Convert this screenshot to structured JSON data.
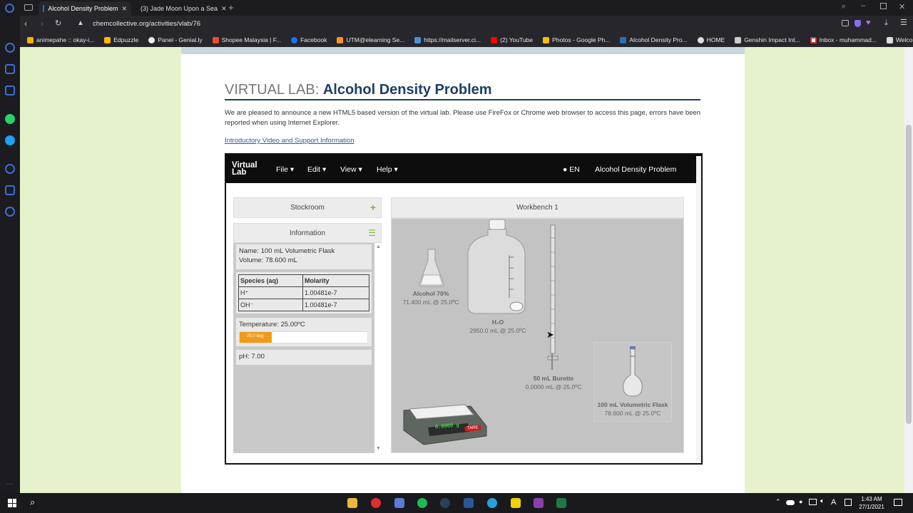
{
  "browser": {
    "tabs": [
      {
        "title": "Alcohol Density Problem",
        "active": true
      },
      {
        "title": "(3) Jade Moon Upon a Sea",
        "active": false
      }
    ],
    "url": "chemcollective.org/activities/vlab/76",
    "bookmarks": [
      "animepahe :: okay-i...",
      "Edpuzzle",
      "Panel - Genial.ly",
      "Shopee Malaysia | F...",
      "Facebook",
      "UTM@elearning Se...",
      "https://mailserver.ci...",
      "(2) YouTube",
      "Photos - Google Ph...",
      "Alcohol Density Pro...",
      "HOME",
      "Genshin Impact Int...",
      "Inbox - muhammad...",
      "Welcome to Slime..."
    ]
  },
  "page": {
    "title_prefix": "VIRTUAL LAB:",
    "title_main": "Alcohol Density Problem",
    "intro": "We are pleased to announce a new HTML5 based version of the virtual lab. Please use FireFox or Chrome web browser to access this page, errors have been reported when using Internet Explorer.",
    "support_link": "Introductory Video and Support Information"
  },
  "vlab": {
    "logo_line1": "Virtual",
    "logo_line2": "Lab",
    "menu": [
      "File",
      "Edit",
      "View",
      "Help"
    ],
    "lang": "EN",
    "problem": "Alcohol Density Problem",
    "stockroom": "Stockroom",
    "information": "Information",
    "info_name": "Name: 100 mL Volumetric Flask",
    "info_volume": "Volume: 78.600 mL",
    "species_headers": [
      "Species (aq)",
      "Molarity"
    ],
    "species_rows": [
      {
        "species": "H⁺",
        "molarity": "1.00481e-7"
      },
      {
        "species": "OH⁻",
        "molarity": "1.00481e-7"
      }
    ],
    "temperature": "Temperature: 25.00ºC",
    "temp_bar_label": "25.0 deg",
    "temp_fraction": 0.25,
    "ph": "pH: 7.00",
    "workbench": "Workbench 1",
    "items": {
      "alcohol_name": "Alcohol 70%",
      "alcohol_vol": "71.400 mL @ 25.0ºC",
      "water_name": "H₂O",
      "water_vol": "2950.0 mL @ 25.0ºC",
      "burette_name": "50 mL Burette",
      "burette_vol": "0.0000 mL @ 25.0ºC",
      "flask_name": "100 mL Volumetric Flask",
      "flask_vol": "78.600 mL @ 25.0ºC",
      "balance_reading": "0.0000 g",
      "tare": "TARE"
    }
  },
  "taskbar": {
    "time": "1:43 AM",
    "date": "27/1/2021",
    "lang_indicator": "A"
  }
}
